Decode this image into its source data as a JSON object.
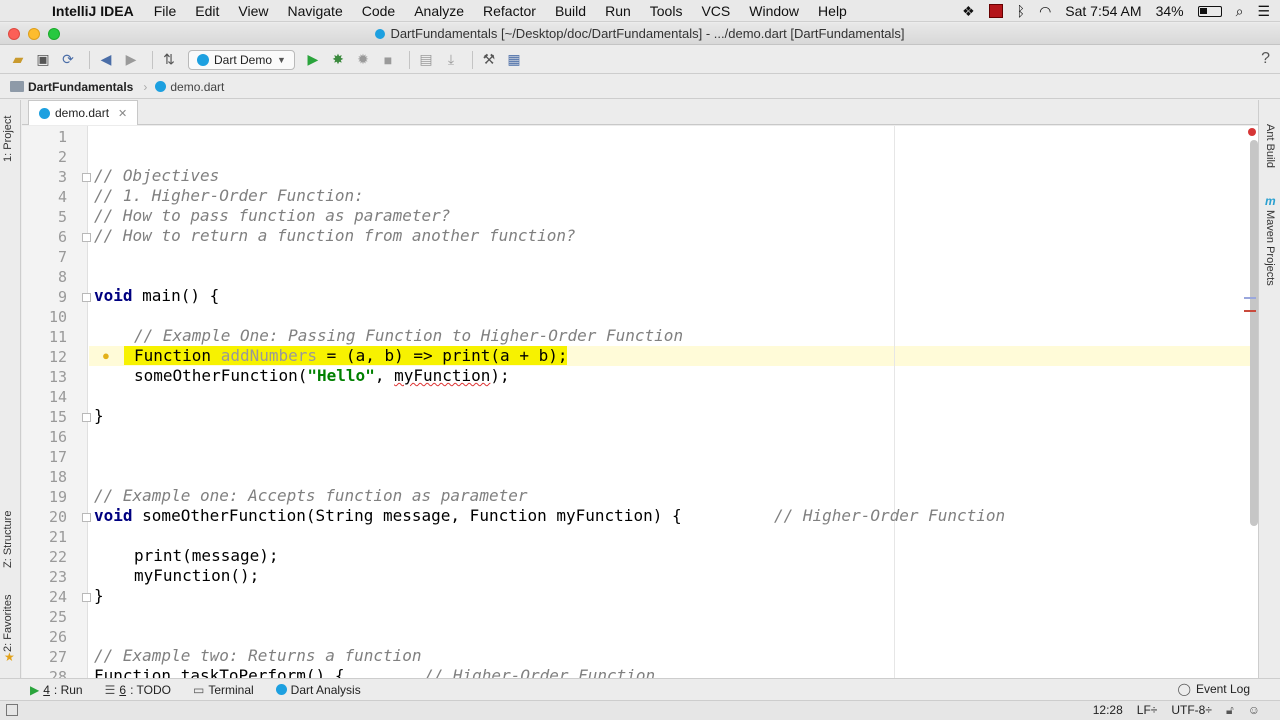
{
  "menubar": {
    "app_name": "IntelliJ IDEA",
    "items": [
      "File",
      "Edit",
      "View",
      "Navigate",
      "Code",
      "Analyze",
      "Refactor",
      "Build",
      "Run",
      "Tools",
      "VCS",
      "Window",
      "Help"
    ],
    "clock": "Sat 7:54 AM",
    "battery": "34%"
  },
  "window": {
    "title": "DartFundamentals [~/Desktop/doc/DartFundamentals] - .../demo.dart [DartFundamentals]"
  },
  "toolbar": {
    "run_config": "Dart Demo"
  },
  "breadcrumb": {
    "project": "DartFundamentals",
    "file": "demo.dart"
  },
  "left_strip": {
    "project": "1: Project",
    "structure": "Z: Structure",
    "favorites": "2: Favorites"
  },
  "right_strip": {
    "ant": "Ant Build",
    "maven": "Maven Projects"
  },
  "tabs": [
    {
      "label": "demo.dart"
    }
  ],
  "editor": {
    "line_numbers": [
      "1",
      "2",
      "3",
      "4",
      "5",
      "6",
      "7",
      "8",
      "9",
      "10",
      "11",
      "12",
      "13",
      "14",
      "15",
      "16",
      "17",
      "18",
      "19",
      "20",
      "21",
      "22",
      "23",
      "24",
      "25",
      "26",
      "27",
      "28"
    ],
    "code": {
      "l3": "// Objectives",
      "l4": "// 1. Higher-Order Function:",
      "l5": "// How to pass function as parameter?",
      "l6": "// How to return a function from another function?",
      "l9_kw": "void",
      "l9_rest": " main() {",
      "l11": "// Example One: Passing Function to Higher-Order Function",
      "l12_type": "Function ",
      "l12_name": "addNumbers",
      "l12_rest": " = (a, b) => print(a + b);",
      "l13_a": "someOtherFunction(",
      "l13_str": "\"Hello\"",
      "l13_b": ", ",
      "l13_c": "myFunction",
      "l13_d": ");",
      "l15": "}",
      "l19": "// Example one: Accepts function as parameter",
      "l20_kw": "void",
      "l20_rest": " someOtherFunction(String message, Function myFunction) {",
      "l20_comment": "// Higher-Order Function",
      "l22": "print(message);",
      "l23": "myFunction();",
      "l24": "}",
      "l27": "// Example two: Returns a function",
      "l28_code": "Function taskToPerform() {",
      "l28_comment": "// Higher-Order Function"
    }
  },
  "bottombar": {
    "run_key": "4",
    "run": ": Run",
    "todo_key": "6",
    "todo": ": TODO",
    "terminal": "Terminal",
    "dart_analysis": "Dart Analysis",
    "event_log": "Event Log"
  },
  "statusbar": {
    "position": "12:28",
    "line_sep": "LF÷",
    "encoding": "UTF-8÷"
  }
}
